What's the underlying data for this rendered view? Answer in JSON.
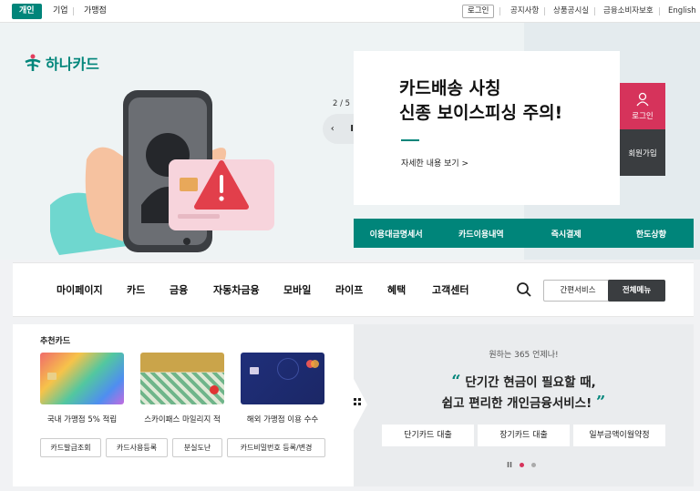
{
  "topbar": {
    "segments": [
      "개인",
      "기업",
      "가맹점"
    ],
    "login": "로그인",
    "links": [
      "공지사항",
      "상품공시실",
      "금융소비자보호",
      "English"
    ]
  },
  "hero": {
    "logo": "하나카드",
    "slide_counter": "2 / 5",
    "headline_line1": "카드배송 사칭",
    "headline_line2": "신종 보이스피싱 주의!",
    "more": "자세한 내용 보기 >",
    "login_button": "로그인",
    "join_button": "회원가입",
    "quick_links": [
      "이용대금명세서",
      "카드이용내역",
      "즉시결제",
      "한도상향"
    ],
    "colors": {
      "brand": "#00857a",
      "login": "#d6335b",
      "dark": "#3a3d40"
    }
  },
  "nav": {
    "items": [
      "마이페이지",
      "카드",
      "금융",
      "자동차금융",
      "모바일",
      "라이프",
      "혜택",
      "고객센터"
    ],
    "easy_service": "간편서비스",
    "all_menu": "전체메뉴"
  },
  "recommend": {
    "title": "추천카드",
    "cards": [
      "국내 가맹점 5% 적립",
      "스카이패스 마일리지 적",
      "해외 가맹점 이용 수수"
    ],
    "buttons": [
      "카드발급조회",
      "카드사용등록",
      "분실도난",
      "카드비밀번호 등록/변경"
    ]
  },
  "promo": {
    "sub": "원하는 365 언제나!",
    "line1": "단기간 현금이 필요할 때,",
    "line2": "쉽고 편리한 개인금융서비스!",
    "buttons": [
      "단기카드 대출",
      "장기카드 대출",
      "일부금액이월약정"
    ],
    "pause": "II"
  }
}
